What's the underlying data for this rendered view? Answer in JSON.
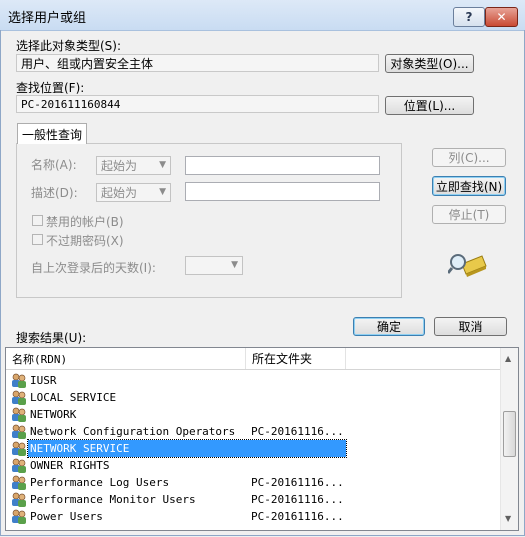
{
  "window": {
    "title": "选择用户或组",
    "help_glyph": "?",
    "close_glyph": "✕"
  },
  "object_type": {
    "label": "选择此对象类型(S):",
    "value": "用户、组或内置安全主体",
    "button": "对象类型(O)..."
  },
  "location": {
    "label": "查找位置(F):",
    "value": "PC-201611160844",
    "button": "位置(L)..."
  },
  "common_query": {
    "tab_label": "一般性查询",
    "name_label": "名称(A):",
    "name_mode": "起始为",
    "name_value": "",
    "desc_label": "描述(D):",
    "desc_mode": "起始为",
    "desc_value": "",
    "disabled_accounts": "禁用的帐户(B)",
    "non_expiring_pw": "不过期密码(X)",
    "days_since_logon_label": "自上次登录后的天数(I):",
    "days_since_logon_value": ""
  },
  "side_buttons": {
    "columns": "列(C)...",
    "find_now": "立即查找(N)",
    "stop": "停止(T)"
  },
  "actions": {
    "ok": "确定",
    "cancel": "取消"
  },
  "results": {
    "label": "搜索结果(U):",
    "columns": [
      "名称(RDN)",
      "所在文件夹"
    ],
    "rows": [
      {
        "name": "IUSR",
        "folder": ""
      },
      {
        "name": "LOCAL SERVICE",
        "folder": ""
      },
      {
        "name": "NETWORK",
        "folder": ""
      },
      {
        "name": "Network Configuration Operators",
        "folder": "PC-20161116..."
      },
      {
        "name": "NETWORK SERVICE",
        "folder": "",
        "selected": true
      },
      {
        "name": "OWNER RIGHTS",
        "folder": ""
      },
      {
        "name": "Performance Log Users",
        "folder": "PC-20161116..."
      },
      {
        "name": "Performance Monitor Users",
        "folder": "PC-20161116..."
      },
      {
        "name": "Power Users",
        "folder": "PC-20161116..."
      }
    ]
  },
  "colors": {
    "selection": "#3399ff",
    "title_bar": "#c9dcf2",
    "dialog_bg": "#f0f0f0"
  }
}
